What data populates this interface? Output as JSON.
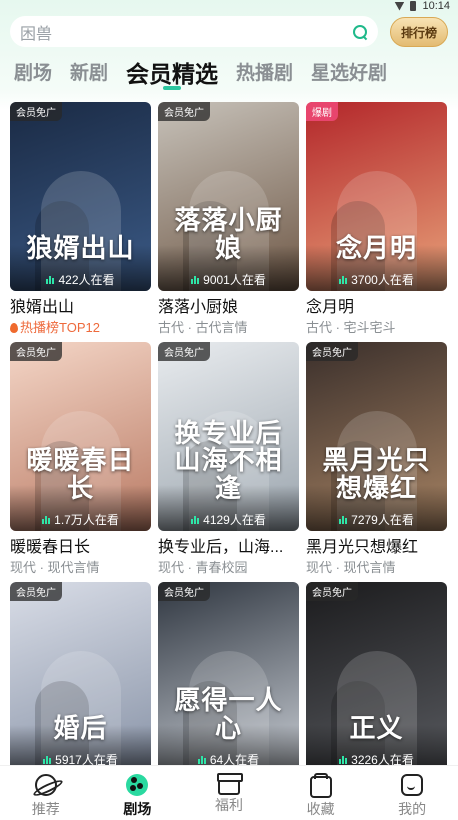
{
  "status": {
    "time": "10:14"
  },
  "search": {
    "placeholder": "困兽",
    "rank_label": "排行榜"
  },
  "tabs": [
    {
      "label": "剧场",
      "active": false
    },
    {
      "label": "新剧",
      "active": false
    },
    {
      "label": "会员精选",
      "active": true
    },
    {
      "label": "热播剧",
      "active": false
    },
    {
      "label": "星选好剧",
      "active": false
    }
  ],
  "dramas": [
    {
      "badge": "会员免广",
      "poster_title": "狼婿出山",
      "viewers": "422人在看",
      "title": "狼婿出山",
      "sub": "热播榜TOP12",
      "sub_type": "rank",
      "color1": "#1a2a44",
      "color2": "#3b5a86"
    },
    {
      "badge": "会员免广",
      "poster_title": "落落小厨娘",
      "viewers": "9001人在看",
      "title": "落落小厨娘",
      "sub": "古代 · 古代言情",
      "sub_type": "tag",
      "color1": "#c7c2ba",
      "color2": "#6f5846"
    },
    {
      "badge": "爆剧",
      "poster_title": "念月明",
      "viewers": "3700人在看",
      "title": "念月明",
      "sub": "古代 · 宅斗宅斗",
      "sub_type": "tag",
      "color1": "#b3262a",
      "color2": "#e8a27a"
    },
    {
      "badge": "会员免广",
      "poster_title": "暖暖春日长",
      "viewers": "1.7万人在看",
      "title": "暖暖春日长",
      "sub": "现代 · 现代言情",
      "sub_type": "tag",
      "color1": "#f4d6c7",
      "color2": "#b97a64"
    },
    {
      "badge": "会员免广",
      "poster_title": "换专业后山海不相逢",
      "viewers": "4129人在看",
      "title": "换专业后，山海...",
      "sub": "现代 · 青春校园",
      "sub_type": "tag",
      "color1": "#e9ecef",
      "color2": "#9aa4ad"
    },
    {
      "badge": "会员免广",
      "poster_title": "黑月光只想爆红",
      "viewers": "7279人在看",
      "title": "黑月光只想爆红",
      "sub": "现代 · 现代言情",
      "sub_type": "tag",
      "color1": "#3a2f2b",
      "color2": "#a78363"
    },
    {
      "badge": "会员免广",
      "poster_title": "婚后",
      "viewers": "5917人在看",
      "title": "",
      "sub": "",
      "sub_type": "tag",
      "color1": "#d9dde7",
      "color2": "#8893a7"
    },
    {
      "badge": "会员免广",
      "poster_title": "愿得一人心",
      "viewers": "64人在看",
      "title": "",
      "sub": "",
      "sub_type": "tag",
      "color1": "#2f3640",
      "color2": "#c7ccd3"
    },
    {
      "badge": "会员免广",
      "poster_title": "正义",
      "viewers": "3226人在看",
      "title": "",
      "sub": "",
      "sub_type": "tag",
      "color1": "#1b1b1d",
      "color2": "#585a5f"
    }
  ],
  "nav": [
    {
      "label": "推荐",
      "icon": "planet-icon",
      "active": false
    },
    {
      "label": "剧场",
      "icon": "theater-icon",
      "active": true
    },
    {
      "label": "福利",
      "icon": "gift-icon",
      "active": false
    },
    {
      "label": "收藏",
      "icon": "folder-icon",
      "active": false
    },
    {
      "label": "我的",
      "icon": "profile-icon",
      "active": false
    }
  ]
}
